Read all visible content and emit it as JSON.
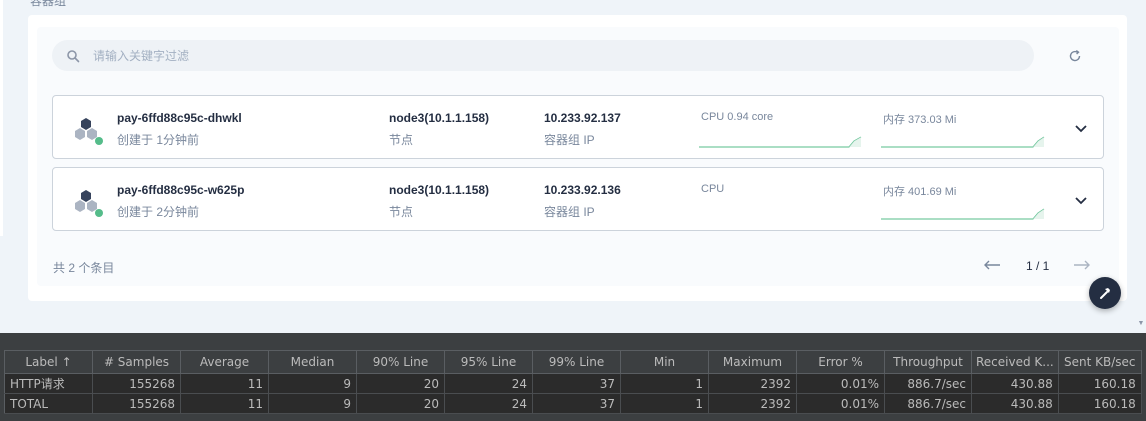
{
  "section_title": "容器组",
  "search": {
    "placeholder": "请输入关键字过滤",
    "value": ""
  },
  "icons": {
    "search": "search-icon",
    "refresh": "refresh-icon",
    "expand": "chevron-down-icon",
    "pod": "pod-hexagons-icon",
    "fab": "hammer-icon"
  },
  "pods": [
    {
      "name": "pay-6ffd88c95c-dhwkl",
      "created": "创建于 1分钟前",
      "node": "node3(10.1.1.158)",
      "node_label": "节点",
      "ip": "10.233.92.137",
      "ip_label": "容器组 IP",
      "cpu_label": "CPU 0.94 core",
      "mem_label": "内存 373.03 Mi",
      "status_color": "#55bc8a"
    },
    {
      "name": "pay-6ffd88c95c-w625p",
      "created": "创建于 2分钟前",
      "node": "node3(10.1.1.158)",
      "node_label": "节点",
      "ip": "10.233.92.136",
      "ip_label": "容器组 IP",
      "cpu_label": "CPU",
      "mem_label": "内存 401.69 Mi",
      "status_color": "#55bc8a"
    }
  ],
  "footer": {
    "total": "共 2 个条目",
    "page": "1 / 1"
  },
  "colors": {
    "spark": "#55bc8a",
    "accent": "#242e42",
    "muted": "#79879c"
  },
  "results_table": {
    "columns": [
      "Label ↑",
      "# Samples",
      "Average",
      "Median",
      "90% Line",
      "95% Line",
      "99% Line",
      "Min",
      "Maximum",
      "Error %",
      "Throughput",
      "Received K...",
      "Sent KB/sec"
    ],
    "rows": [
      [
        "HTTP请求",
        "155268",
        "11",
        "9",
        "20",
        "24",
        "37",
        "1",
        "2392",
        "0.01%",
        "886.7/sec",
        "430.88",
        "160.18"
      ],
      [
        "TOTAL",
        "155268",
        "11",
        "9",
        "20",
        "24",
        "37",
        "1",
        "2392",
        "0.01%",
        "886.7/sec",
        "430.88",
        "160.18"
      ]
    ]
  }
}
